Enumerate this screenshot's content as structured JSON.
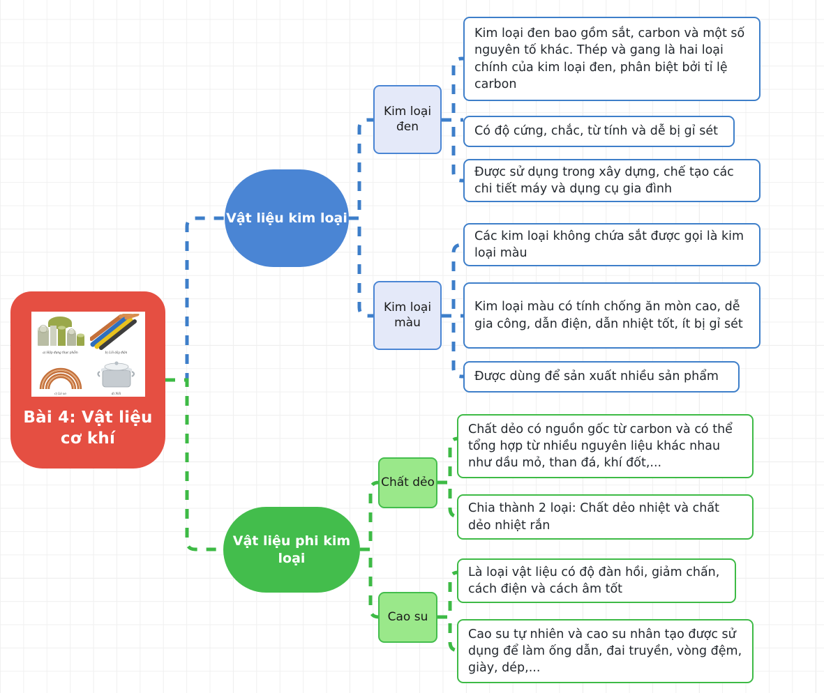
{
  "diagram": {
    "title": "Bài 4: Vật liệu cơ khí",
    "type": "mindmap"
  },
  "root": {
    "label": "Bài 4: Vật liệu cơ khí",
    "color": "#e54f42",
    "image": {
      "name": "materials-photo-grid",
      "captions": [
        "a) Hộp đựng thực phẩm",
        "b) Lõi dây điện",
        "c) Lò xo",
        "d) Nồi"
      ]
    }
  },
  "branches": [
    {
      "id": "metal",
      "label": "Vật liệu kim loại",
      "color": "#4a85d4",
      "categories": [
        {
          "id": "kim-loai-den",
          "label": "Kim loại đen",
          "items": [
            "Kim loại đen bao gồm sắt, carbon và một số nguyên tố khác. Thép và gang là hai loại chính của kim loại đen, phân biệt bởi tỉ lệ carbon",
            "Có độ cứng, chắc, từ tính và dễ bị gỉ sét",
            "Được sử dụng trong xây dựng, chế tạo các chi tiết máy và dụng cụ gia đình"
          ]
        },
        {
          "id": "kim-loai-mau",
          "label": "Kim loại màu",
          "items": [
            "Các kim loại không chứa sắt được gọi là kim loại màu",
            "Kim loại màu có tính chống ăn mòn cao, dễ gia công, dẫn điện, dẫn nhiệt tốt, ít bị gỉ sét",
            "Được dùng để sản xuất nhiều sản phẩm"
          ]
        }
      ]
    },
    {
      "id": "nonmetal",
      "label": "Vật liệu phi kim loại",
      "color": "#43bd4c",
      "categories": [
        {
          "id": "chat-deo",
          "label": "Chất dẻo",
          "items": [
            "Chất dẻo có nguồn gốc từ carbon và có thể tổng hợp từ nhiều nguyên liệu khác nhau như dầu mỏ, than đá, khí đốt,...",
            "Chia thành 2 loại: Chất dẻo nhiệt và chất dẻo nhiệt rắn"
          ]
        },
        {
          "id": "cao-su",
          "label": "Cao su",
          "items": [
            "Là loại vật liệu có độ đàn hồi, giảm chấn, cách điện và cách âm tốt",
            "Cao su tự nhiên và cao su nhân tạo được sử dụng để làm ống dẫn, đai truyền, vòng đệm, giày, dép,..."
          ]
        }
      ]
    }
  ],
  "colors": {
    "root": "#e54f42",
    "metal": "#4a85d4",
    "nonmetal": "#43bd4c",
    "metal_box_fill": "#e4e9f9",
    "nonmetal_box_fill": "#9ae88a",
    "grid": "#e6e6e6"
  }
}
